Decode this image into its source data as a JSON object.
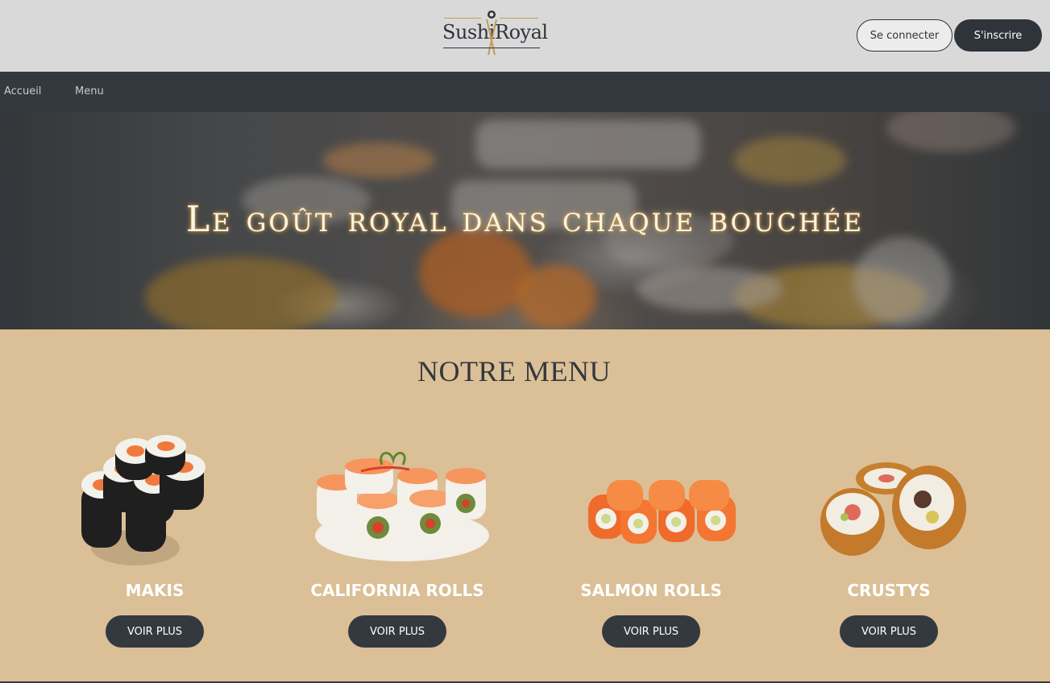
{
  "header": {
    "logo_left": "Sushi",
    "logo_right": "Royal",
    "login_label": "Se connecter",
    "signup_label": "S'inscrire"
  },
  "nav": {
    "items": [
      {
        "label": "Accueil"
      },
      {
        "label": "Menu"
      }
    ]
  },
  "hero": {
    "title": "Le goût royal dans chaque bouchée"
  },
  "menu": {
    "title": "NOTRE MENU",
    "cards": [
      {
        "name": "MAKIS",
        "button": "VOIR PLUS"
      },
      {
        "name": "CALIFORNIA ROLLS",
        "button": "VOIR PLUS"
      },
      {
        "name": "SALMON ROLLS",
        "button": "VOIR PLUS"
      },
      {
        "name": "CRUSTYS",
        "button": "VOIR PLUS"
      }
    ]
  },
  "colors": {
    "header_bg": "#d9d9d9",
    "nav_bg": "#343940",
    "section_bg": "#dbbf96",
    "button_dark": "#2f343b",
    "accent_gold": "#c59b57"
  }
}
